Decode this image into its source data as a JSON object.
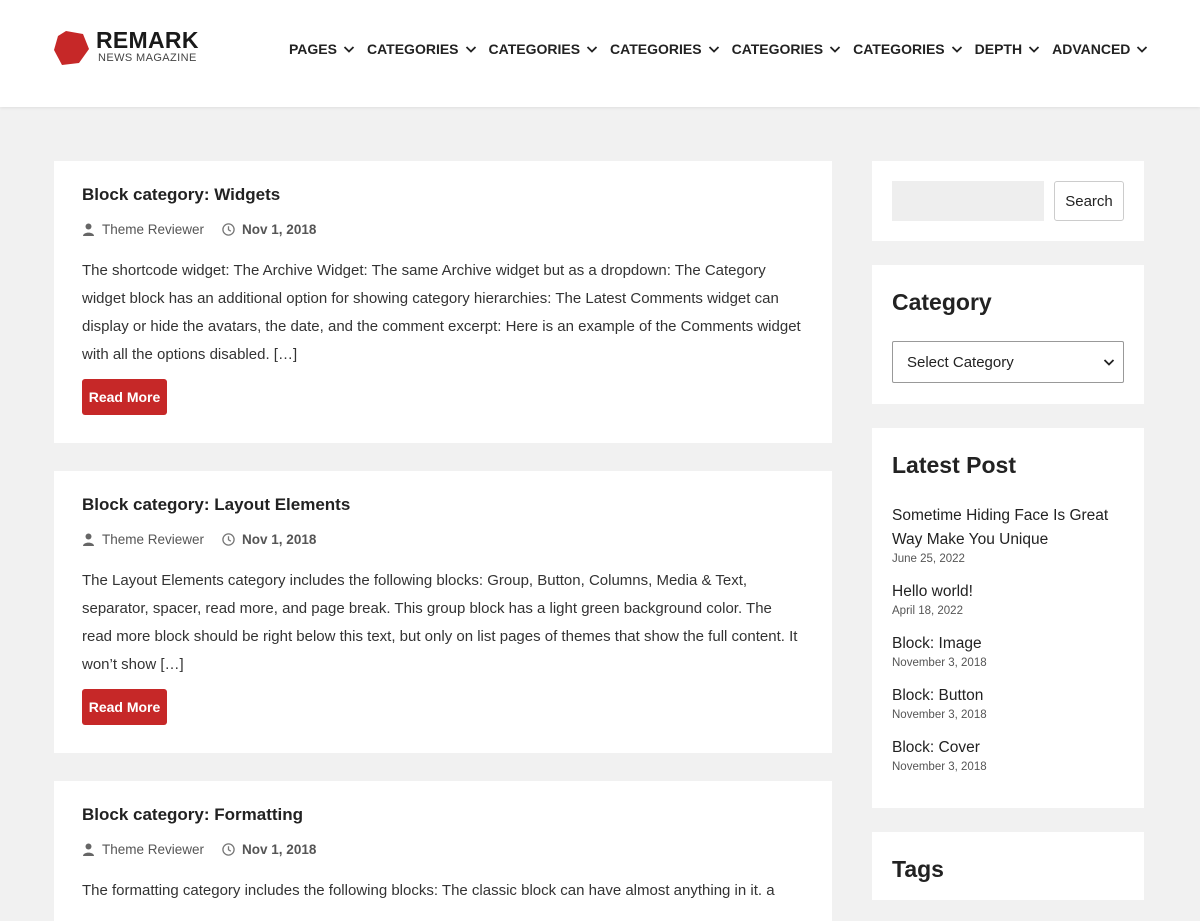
{
  "brand": {
    "title": "REMARK",
    "subtitle": "NEWS MAGAZINE",
    "accent": "#c62828"
  },
  "nav": [
    {
      "label": "PAGES"
    },
    {
      "label": "CATEGORIES"
    },
    {
      "label": "CATEGORIES"
    },
    {
      "label": "CATEGORIES"
    },
    {
      "label": "CATEGORIES"
    },
    {
      "label": "CATEGORIES"
    },
    {
      "label": "DEPTH"
    },
    {
      "label": "ADVANCED"
    }
  ],
  "posts": [
    {
      "title": "Block category: Widgets",
      "author": "Theme Reviewer",
      "date": "Nov 1, 2018",
      "excerpt": "The shortcode widget: The Archive Widget: The same Archive widget but as a dropdown: The Category widget block has an additional option for showing category hierarchies: The Latest Comments widget can display or hide the avatars, the date, and the comment excerpt: Here is an example of the Comments widget with all the options disabled. […]",
      "read_more": "Read More"
    },
    {
      "title": "Block category: Layout Elements",
      "author": "Theme Reviewer",
      "date": "Nov 1, 2018",
      "excerpt": "The Layout Elements category includes the following blocks: Group, Button, Columns, Media & Text, separator, spacer, read more, and page break. This group block has a light green background color. The read more block should be right below this text, but only on list pages of themes that show the full content. It won’t show […]",
      "read_more": "Read More"
    },
    {
      "title": "Block category: Formatting",
      "author": "Theme Reviewer",
      "date": "Nov 1, 2018",
      "excerpt": "The formatting category includes the following blocks: The classic block can have almost anything in it. a"
    }
  ],
  "sidebar": {
    "search": {
      "placeholder": "",
      "button": "Search"
    },
    "category": {
      "title": "Category",
      "selected": "Select Category"
    },
    "latest": {
      "title": "Latest Post",
      "items": [
        {
          "title": "Sometime Hiding Face Is Great Way Make You Unique",
          "date": "June 25, 2022"
        },
        {
          "title": "Hello world!",
          "date": "April 18, 2022"
        },
        {
          "title": "Block: Image",
          "date": "November 3, 2018"
        },
        {
          "title": "Block: Button",
          "date": "November 3, 2018"
        },
        {
          "title": "Block: Cover",
          "date": "November 3, 2018"
        }
      ]
    },
    "tags": {
      "title": "Tags"
    }
  },
  "icons": {
    "author": "user-icon",
    "date": "clock-icon",
    "nav": "chevron-down-icon"
  }
}
